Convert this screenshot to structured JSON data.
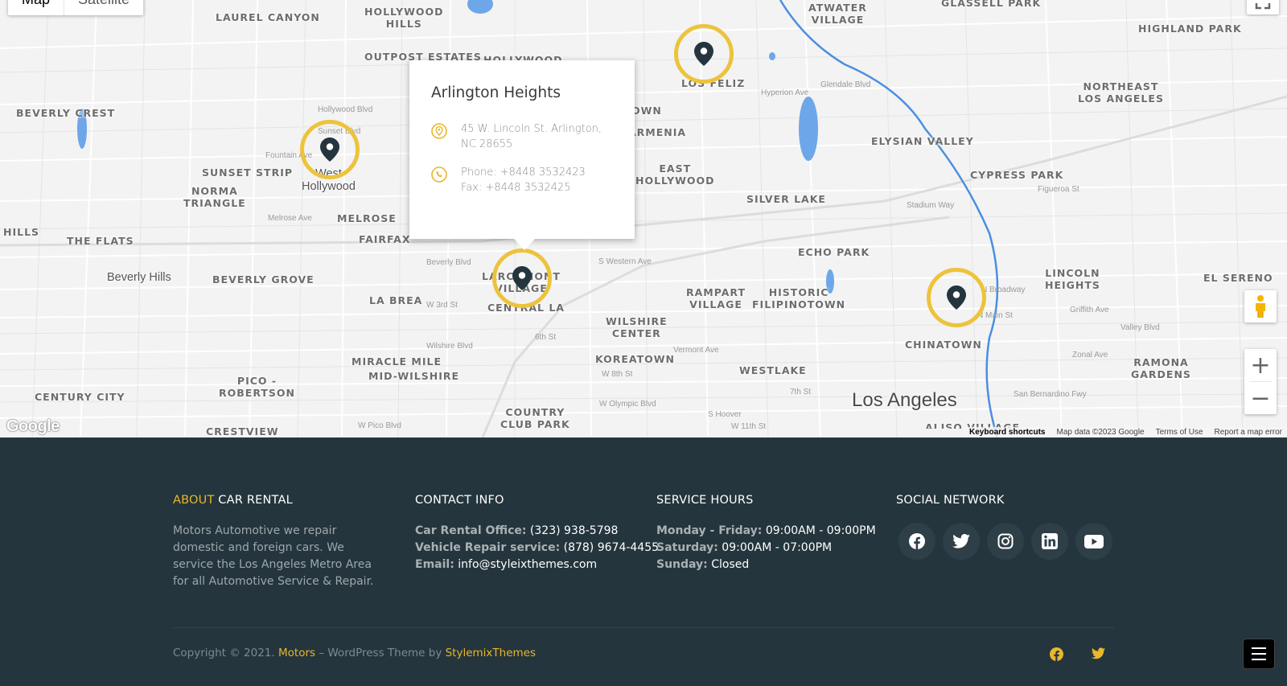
{
  "map": {
    "type_buttons": [
      "Map",
      "Satellite"
    ],
    "places": [
      {
        "t": "LAUREL CANYON"
      },
      {
        "t": "HOLLYWOOD\nHILLS"
      },
      {
        "t": "OUTPOST ESTATES"
      },
      {
        "t": "HOLLYWOOD"
      },
      {
        "t": "ATWATER\nVILLAGE"
      },
      {
        "t": "GLASSELL PARK"
      },
      {
        "t": "HIGHLAND PARK"
      },
      {
        "t": "BEVERLY CREST"
      },
      {
        "t": "LOS FELIZ"
      },
      {
        "t": "NORTHEAST\nLOS ANGELES"
      },
      {
        "t": "ELYSIAN VALLEY"
      },
      {
        "t": "CYPRESS PARK"
      },
      {
        "t": "SUNSET STRIP"
      },
      {
        "t": "NORMA\nTRIANGLE"
      },
      {
        "t": "EAST\nHOLLYWOOD"
      },
      {
        "t": "SILVER LAKE"
      },
      {
        "t": "MELROSE"
      },
      {
        "t": "FAIRFAX"
      },
      {
        "t": "HILLS"
      },
      {
        "t": "THE FLATS"
      },
      {
        "t": "ECHO PARK"
      },
      {
        "t": "LINCOLN\nHEIGHTS"
      },
      {
        "t": "EL SERENO"
      },
      {
        "t": "BEVERLY GROVE"
      },
      {
        "t": "LARCHMONT\nVILLAGE"
      },
      {
        "t": "LA BREA"
      },
      {
        "t": "CENTRAL LA"
      },
      {
        "t": "RAMPART\nVILLAGE"
      },
      {
        "t": "HISTORIC\nFILIPINOTOWN"
      },
      {
        "t": "WILSHIRE\nCENTER"
      },
      {
        "t": "CHINATOWN"
      },
      {
        "t": "MIRACLE MILE"
      },
      {
        "t": "MID-WILSHIRE"
      },
      {
        "t": "KOREATOWN"
      },
      {
        "t": "WESTLAKE"
      },
      {
        "t": "RAMONA\nGARDENS"
      },
      {
        "t": "PICO -\nROBERTSON"
      },
      {
        "t": "CENTURY CITY"
      },
      {
        "t": "COUNTRY\nCLUB PARK"
      },
      {
        "t": "CRESTVIEW"
      },
      {
        "t": "ALISO VILLAGE"
      },
      {
        "t": "ARMENIA"
      },
      {
        "t": "OWN"
      }
    ],
    "city_label": "Los Angeles",
    "medium_labels": [
      "Beverly Hills",
      "West\nHollywood"
    ],
    "streets": [
      "Hollywood Blvd",
      "Sunset Blvd",
      "Fountain Ave",
      "Melrose Ave",
      "Beverly Blvd",
      "W 3rd St",
      "Wilshire Blvd",
      "6th St",
      "W Olympic Blvd",
      "W Pico Blvd",
      "S Western Ave",
      "Vermont Ave",
      "W 8th St",
      "Glendale Blvd",
      "Stadium Way",
      "Figueroa St",
      "N Broadway",
      "N Main St",
      "San Bernardino Fwy",
      "Valley Blvd",
      "Zonal Ave",
      "Hyperion Ave",
      "Griffith Ave",
      "W 11th St",
      "S Hoover",
      "7th St"
    ],
    "attribution": [
      "Keyboard shortcuts",
      "Map data ©2023 Google",
      "Terms of Use",
      "Report a map error"
    ],
    "google_logo": "Google",
    "zoom_in": "+",
    "zoom_out": "−",
    "marker_color": "#edc33c",
    "pin_color": "#24353d"
  },
  "infowindow": {
    "title": "Arlington Heights",
    "address": "45 W. Lincoln St. Arlington, NC 28655",
    "phone": "Phone: +8448 3532423",
    "fax": "Fax: +8448 3532425",
    "address_icon": "location-pin-icon",
    "phone_icon": "phone-icon"
  },
  "footer": {
    "accent_color": "#e8b72c",
    "about": {
      "title_accent": "ABOUT",
      "title_rest": " CAR RENTAL",
      "text": "Motors Automotive we repair domestic and foreign cars. We service the Los Angeles Metro Area for all Automotive Service & Repair."
    },
    "contact": {
      "title": "CONTACT INFO",
      "lines": [
        {
          "label": "Car Rental Office:",
          "value": " (323) 938-5798"
        },
        {
          "label": "Vehicle Repair service:",
          "value": " (878) 9674-4455"
        },
        {
          "label": "Email:",
          "value": " info@styleixthemes.com"
        }
      ]
    },
    "hours": {
      "title": "SERVICE HOURS",
      "lines": [
        {
          "label": "Monday - Friday:",
          "value": " 09:00AM - 09:00PM"
        },
        {
          "label": "Saturday:",
          "value": " 09:00AM - 07:00PM"
        },
        {
          "label": "Sunday:",
          "value": " Closed"
        }
      ]
    },
    "social": {
      "title": "SOCIAL NETWORK",
      "icons": [
        "facebook-icon",
        "twitter-icon",
        "instagram-icon",
        "linkedin-icon",
        "youtube-icon"
      ]
    },
    "copyright": {
      "prefix": "Copyright © 2021. ",
      "brand": "Motors",
      "middle": " – WordPress Theme by ",
      "author": "StylemixThemes"
    },
    "bottom_social": [
      "facebook-icon",
      "twitter-icon"
    ]
  }
}
